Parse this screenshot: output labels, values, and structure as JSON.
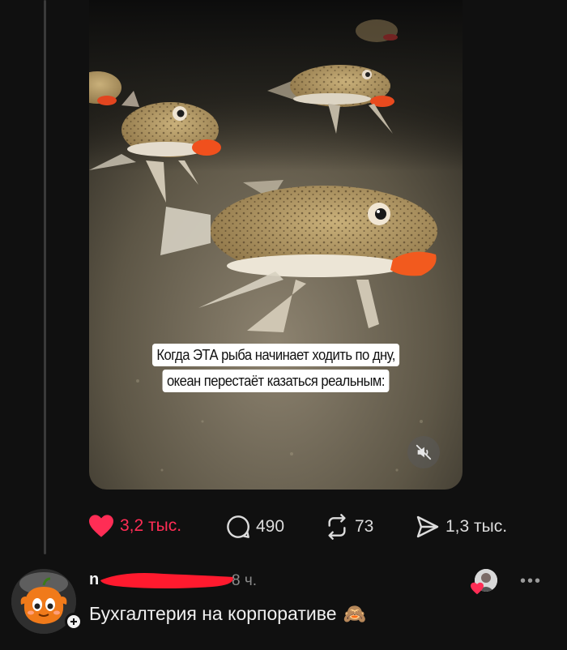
{
  "media": {
    "caption_lines": [
      "Когда ЭТА рыба начинает ходить по дну,",
      "океан перестаёт казаться реальным:"
    ],
    "mute_icon": "speaker-muted-icon"
  },
  "actions": {
    "likes": "3,2 тыс.",
    "replies": "490",
    "reposts": "73",
    "shares": "1,3 тыс."
  },
  "comment": {
    "username": "n",
    "time": "8 ч.",
    "text": "Бухгалтерия на корпоративе",
    "emoji": "🙈",
    "more_label": "•••"
  },
  "colors": {
    "background": "#101010",
    "like": "#ff2d55",
    "redaction": "#ff1a2e"
  }
}
